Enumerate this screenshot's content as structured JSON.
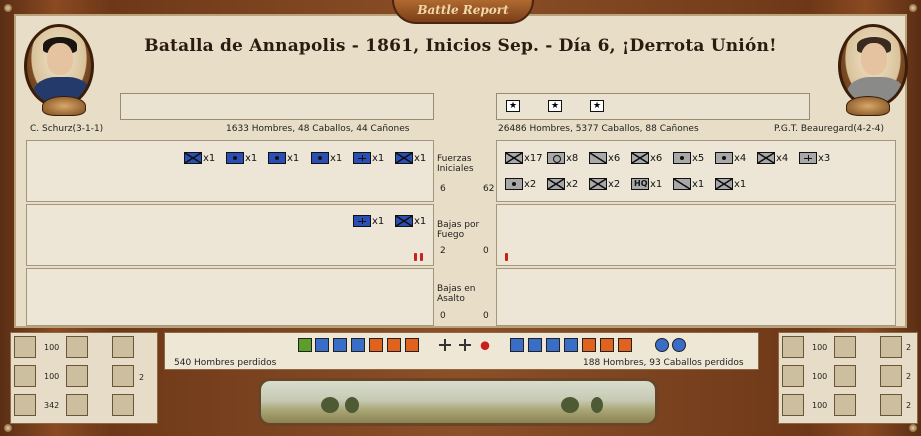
{
  "header": {
    "plaque": "Battle Report",
    "title": "Batalla de Annapolis - 1861, Inicios Sep. - Día 6, ¡Derrota Unión!"
  },
  "union": {
    "commander": "C. Schurz(3-1-1)",
    "strength": "1633 Hombres, 48 Caballos, 44 Cañones",
    "initial_units": [
      {
        "icon": "infantry-icon",
        "count": "x1"
      },
      {
        "icon": "dot-unit-icon",
        "count": "x1"
      },
      {
        "icon": "dot-unit-icon",
        "count": "x1"
      },
      {
        "icon": "artillery-icon",
        "count": "x1"
      },
      {
        "icon": "engineer-icon",
        "count": "x1"
      },
      {
        "icon": "cavalry-infantry-icon",
        "count": "x1"
      }
    ],
    "fire_losses_units": [
      {
        "icon": "engineer-icon",
        "count": "x1"
      },
      {
        "icon": "cavalry-infantry-icon",
        "count": "x1"
      }
    ],
    "lost": "540 Hombres perdidos",
    "stats": [
      "100",
      "100",
      "342"
    ],
    "side_stat": "2"
  },
  "confederate": {
    "commander": "P.G.T. Beauregard(4-2-4)",
    "strength": "26486 Hombres, 5377 Caballos, 88 Cañones",
    "stars": [
      "★",
      "★",
      "★"
    ],
    "initial_units": [
      {
        "icon": "infantry-icon",
        "count": "x17"
      },
      {
        "icon": "ring-unit-icon",
        "count": "x8"
      },
      {
        "icon": "cavalry-icon",
        "count": "x6"
      },
      {
        "icon": "infantry-icon",
        "count": "x6"
      },
      {
        "icon": "dot-unit-icon",
        "count": "x5"
      },
      {
        "icon": "dot-unit-icon",
        "count": "x4"
      },
      {
        "icon": "infantry-icon",
        "count": "x4"
      },
      {
        "icon": "cross-unit-icon",
        "count": "x3"
      },
      {
        "icon": "dot-unit-icon",
        "count": "x2"
      },
      {
        "icon": "infantry-icon",
        "count": "x2"
      },
      {
        "icon": "infantry-icon",
        "count": "x2"
      },
      {
        "icon": "hq-icon",
        "count": "x1"
      },
      {
        "icon": "cavalry-icon",
        "count": "x1"
      },
      {
        "icon": "infantry-icon",
        "count": "x1"
      }
    ],
    "lost": "188 Hombres, 93 Caballos perdidos",
    "stats": [
      "100",
      "100",
      "100"
    ],
    "side_stats": [
      "2",
      "2",
      "2"
    ]
  },
  "rows": {
    "initial": {
      "label": "Fuerzas Iniciales",
      "union_val": "6",
      "conf_val": "62"
    },
    "fire": {
      "label": "Bajas por Fuego",
      "union_val": "2",
      "conf_val": "0"
    },
    "assault": {
      "label": "Bajas en Asalto",
      "union_val": "0",
      "conf_val": "0"
    }
  },
  "colors": {
    "union": "#2a4fb4",
    "confederate": "#a8a8a8",
    "casualty": "#c8201a"
  }
}
